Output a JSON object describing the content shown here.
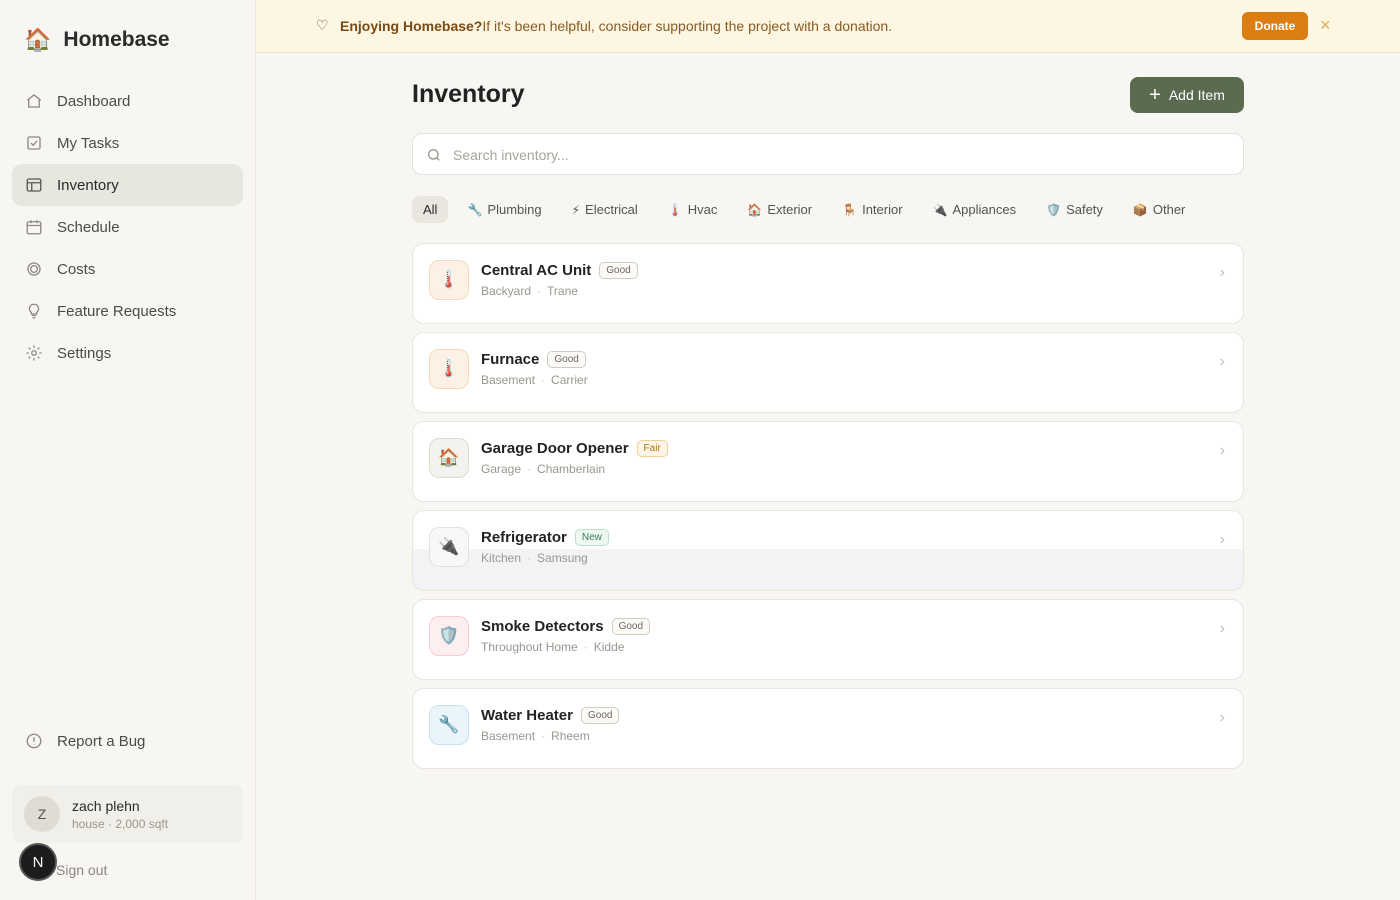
{
  "sidebar": {
    "brand": "Homebase",
    "nav": [
      {
        "label": "Dashboard",
        "icon": "home-icon"
      },
      {
        "label": "My Tasks",
        "icon": "checkbox-icon"
      },
      {
        "label": "Inventory",
        "icon": "table-icon",
        "active": true
      },
      {
        "label": "Schedule",
        "icon": "calendar-icon"
      },
      {
        "label": "Costs",
        "icon": "coin-icon"
      },
      {
        "label": "Feature Requests",
        "icon": "lightbulb-icon"
      },
      {
        "label": "Settings",
        "icon": "gear-icon"
      }
    ],
    "report_bug": "Report a Bug",
    "user": {
      "initial": "Z",
      "name": "zach plehn",
      "sub": "house · 2,000 sqft"
    },
    "sign_out": "Sign out",
    "n_badge": "N"
  },
  "banner": {
    "bold": "Enjoying Homebase?",
    "text": "If it's been helpful, consider supporting the project with a donation.",
    "donate": "Donate",
    "close": "×"
  },
  "main": {
    "title": "Inventory",
    "add_label": "Add Item",
    "search_placeholder": "Search inventory...",
    "filters": [
      {
        "label": "All",
        "icon": "",
        "active": true
      },
      {
        "label": "Plumbing",
        "icon": "🔧"
      },
      {
        "label": "Electrical",
        "icon": "⚡"
      },
      {
        "label": "Hvac",
        "icon": "🌡️"
      },
      {
        "label": "Exterior",
        "icon": "🏠"
      },
      {
        "label": "Interior",
        "icon": "🪑"
      },
      {
        "label": "Appliances",
        "icon": "🔌"
      },
      {
        "label": "Safety",
        "icon": "🛡️"
      },
      {
        "label": "Other",
        "icon": "📦"
      }
    ],
    "items": [
      {
        "name": "Central AC Unit",
        "status": "Good",
        "location": "Backyard",
        "brand": "Trane",
        "icon": "🌡️",
        "icon_bg": "#fdf1e6",
        "icon_border": "#f3d9bf"
      },
      {
        "name": "Furnace",
        "status": "Good",
        "location": "Basement",
        "brand": "Carrier",
        "icon": "🌡️",
        "icon_bg": "#fdf1e6",
        "icon_border": "#f3d9bf"
      },
      {
        "name": "Garage Door Opener",
        "status": "Fair",
        "location": "Garage",
        "brand": "Chamberlain",
        "icon": "🏠",
        "icon_bg": "#f3f2ee",
        "icon_border": "#dedbd3"
      },
      {
        "name": "Refrigerator",
        "status": "New",
        "location": "Kitchen",
        "brand": "Samsung",
        "icon": "🔌",
        "icon_bg": "#f7f7f7",
        "icon_border": "#e2e2e2"
      },
      {
        "name": "Smoke Detectors",
        "status": "Good",
        "location": "Throughout Home",
        "brand": "Kidde",
        "icon": "🛡️",
        "icon_bg": "#fdeef0",
        "icon_border": "#f3cfd5"
      },
      {
        "name": "Water Heater",
        "status": "Good",
        "location": "Basement",
        "brand": "Rheem",
        "icon": "🔧",
        "icon_bg": "#eaf4fb",
        "icon_border": "#c9e1f0"
      }
    ]
  }
}
